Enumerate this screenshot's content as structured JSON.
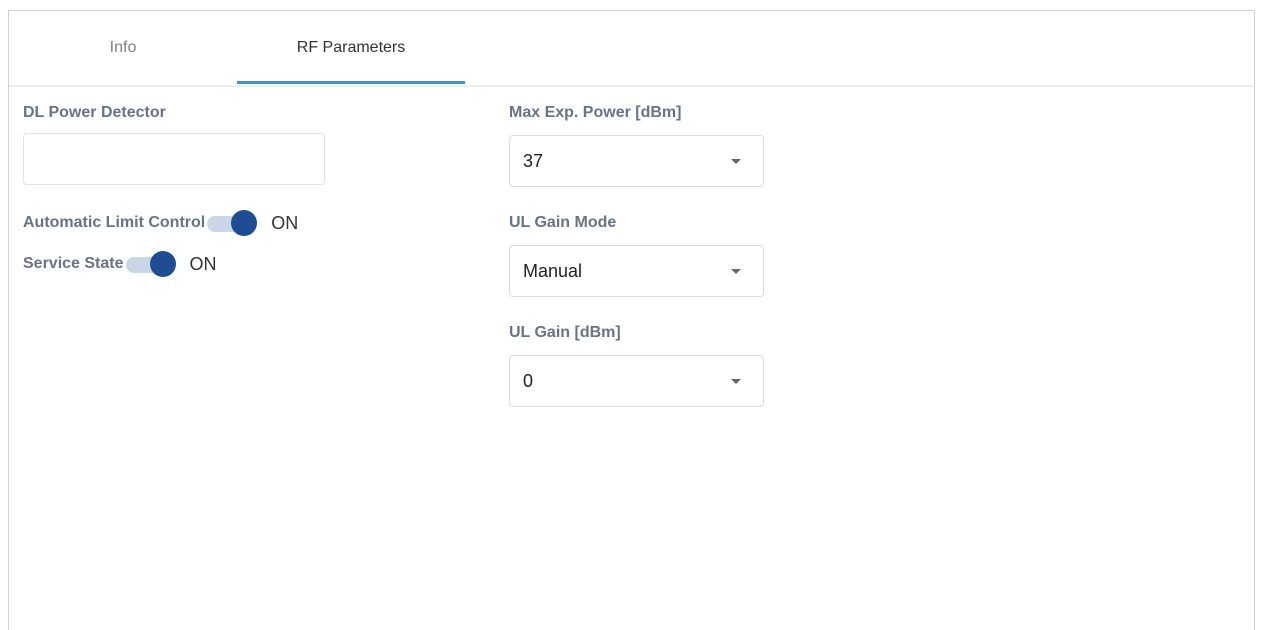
{
  "tabs": [
    {
      "label": "Info",
      "active": false
    },
    {
      "label": "RF Parameters",
      "active": true
    }
  ],
  "left": {
    "dl_power_detector": {
      "label": "DL Power Detector",
      "value": ""
    },
    "automatic_limit_control": {
      "label": "Automatic Limit Control",
      "state": "ON"
    },
    "service_state": {
      "label": "Service State",
      "state": "ON"
    }
  },
  "right": {
    "max_exp_power": {
      "label": "Max Exp. Power [dBm]",
      "value": "37"
    },
    "ul_gain_mode": {
      "label": "UL Gain Mode",
      "value": "Manual"
    },
    "ul_gain": {
      "label": "UL Gain [dBm]",
      "value": "0"
    }
  },
  "colors": {
    "accent": "#3f8fd2",
    "toggle_knob": "#1f4d93",
    "toggle_track": "#c9d6e8",
    "label": "#6a7383"
  },
  "icons": {
    "select_caret": "caret-down-icon"
  }
}
